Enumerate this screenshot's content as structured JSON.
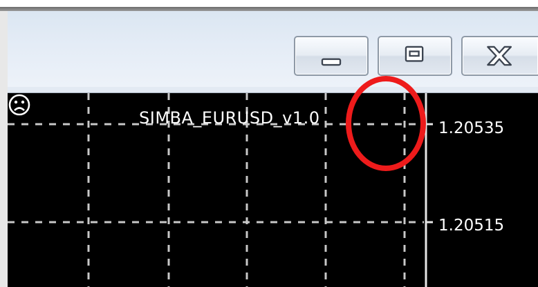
{
  "window": {
    "controls": {
      "minimize_icon": "minimize-icon",
      "maximize_icon": "restore-icon",
      "close_icon": "close-icon"
    }
  },
  "chart": {
    "expert_advisor_label": "SIMBA_EURUSD_v1.0",
    "expert_status_icon": "sad-face-icon",
    "price_labels": [
      "1.20535",
      "1.20515"
    ],
    "background_color": "#000000",
    "grid_color": "#c8c8c8",
    "grid": true
  },
  "annotation": {
    "circle_color": "#ee1b1b"
  }
}
